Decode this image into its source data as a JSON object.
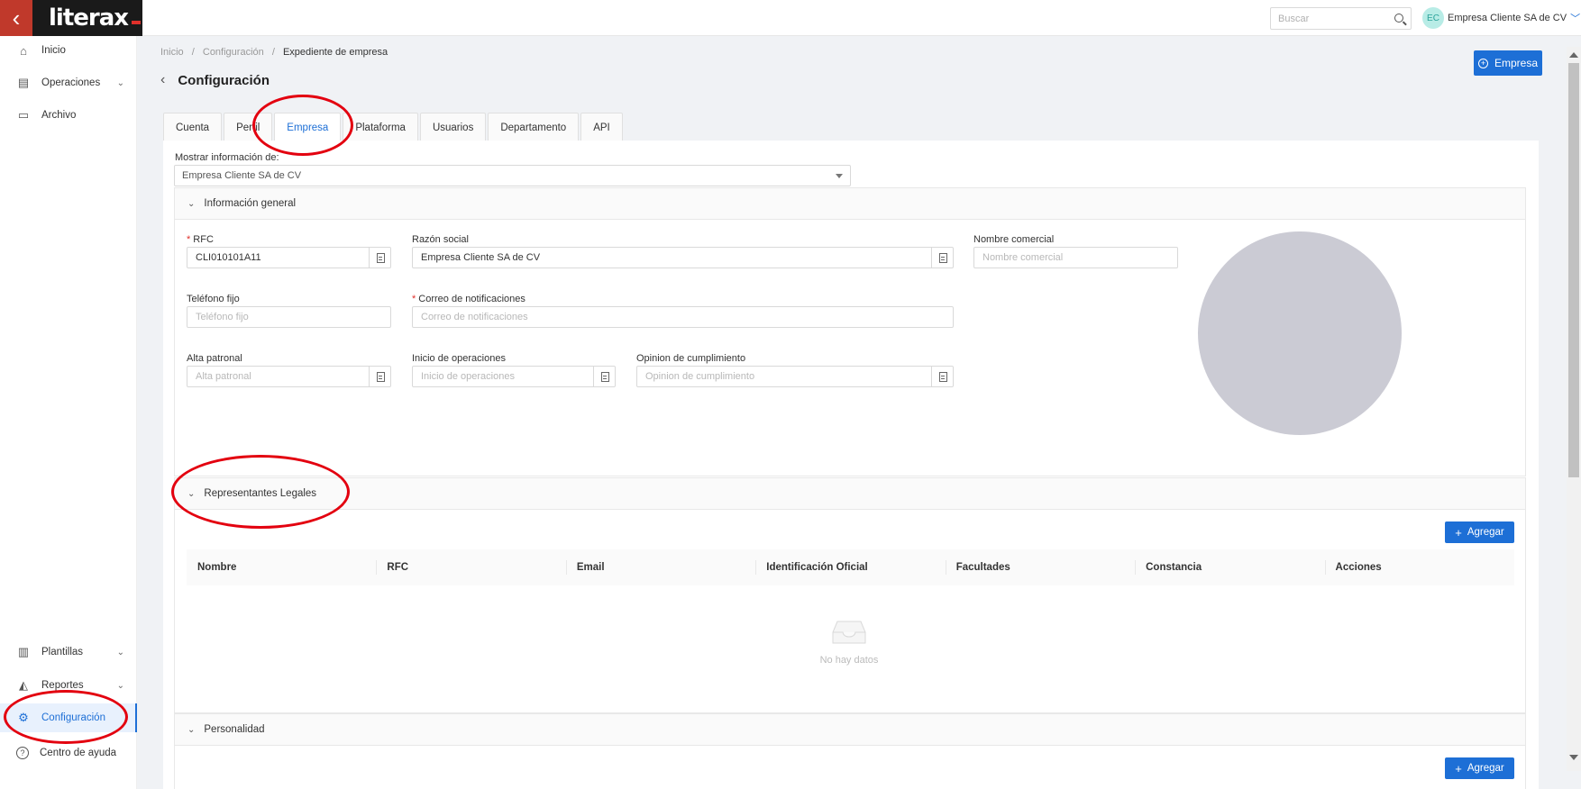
{
  "topbar": {
    "logo_text": "literax",
    "back_glyph": "‹",
    "search_placeholder": "Buscar",
    "user_initials": "EC",
    "user_name": "Empresa Cliente SA de CV",
    "user_chevron": "﹀"
  },
  "sidebar": {
    "items": [
      {
        "label": "Inicio",
        "icon": "home-icon",
        "glyph": "⌂",
        "chevron": ""
      },
      {
        "label": "Operaciones",
        "icon": "operations-icon",
        "glyph": "▤",
        "chevron": "⌄"
      },
      {
        "label": "Archivo",
        "icon": "folder-icon",
        "glyph": "▭",
        "chevron": ""
      },
      {
        "label": "Plantillas",
        "icon": "templates-icon",
        "glyph": "▥",
        "chevron": "⌄"
      },
      {
        "label": "Reportes",
        "icon": "reports-icon",
        "glyph": "◭",
        "chevron": "⌄"
      },
      {
        "label": "Configuración",
        "icon": "gear-icon",
        "glyph": "⚙",
        "chevron": ""
      },
      {
        "label": "Centro de ayuda",
        "icon": "help-icon",
        "glyph": "?",
        "chevron": ""
      }
    ],
    "active_index": 5
  },
  "breadcrumb": {
    "items": [
      "Inicio",
      "Configuración",
      "Expediente de empresa"
    ],
    "separator": "/"
  },
  "page": {
    "back_glyph": "‹",
    "title": "Configuración",
    "empresa_button_label": "Empresa",
    "empresa_button_glyph": "+"
  },
  "tabs": {
    "items": [
      "Cuenta",
      "Perfil",
      "Empresa",
      "Plataforma",
      "Usuarios",
      "Departamento",
      "API"
    ],
    "active": "Empresa"
  },
  "filter": {
    "label": "Mostrar información de:",
    "selected": "Empresa Cliente SA de CV"
  },
  "general_info": {
    "header": "Información general",
    "chevron": "⌄",
    "fields": {
      "rfc": {
        "label": "RFC",
        "required": true,
        "value": "CLI010101A11",
        "placeholder": ""
      },
      "razon_social": {
        "label": "Razón social",
        "required": false,
        "value": "Empresa Cliente SA de CV",
        "placeholder": ""
      },
      "nombre_comercial": {
        "label": "Nombre comercial",
        "required": false,
        "value": "",
        "placeholder": "Nombre comercial"
      },
      "telefono_fijo": {
        "label": "Teléfono fijo",
        "required": false,
        "value": "",
        "placeholder": "Teléfono fijo"
      },
      "correo": {
        "label": "Correo de notificaciones",
        "required": true,
        "value": "",
        "placeholder": "Correo de notificaciones"
      },
      "alta_patronal": {
        "label": "Alta patronal",
        "required": false,
        "value": "",
        "placeholder": "Alta patronal"
      },
      "inicio_operaciones": {
        "label": "Inicio de operaciones",
        "required": false,
        "value": "",
        "placeholder": "Inicio de operaciones"
      },
      "opinion_cumplimiento": {
        "label": "Opinion de cumplimiento",
        "required": false,
        "value": "",
        "placeholder": "Opinion de cumplimiento"
      }
    },
    "required_mark": "*"
  },
  "legal_reps": {
    "header": "Representantes Legales",
    "chevron": "⌄",
    "add_button_label": "Agregar",
    "add_glyph": "+",
    "columns": [
      "Nombre",
      "RFC",
      "Email",
      "Identificación Oficial",
      "Facultades",
      "Constancia",
      "Acciones"
    ],
    "rows": [],
    "empty_text": "No hay datos"
  },
  "personality": {
    "header": "Personalidad",
    "chevron": "⌄",
    "add_button_label": "Agregar",
    "add_glyph": "+"
  },
  "colors": {
    "accent": "#1d6fd6",
    "brand_red": "#c0392b",
    "annotation_red": "#e3000f"
  }
}
